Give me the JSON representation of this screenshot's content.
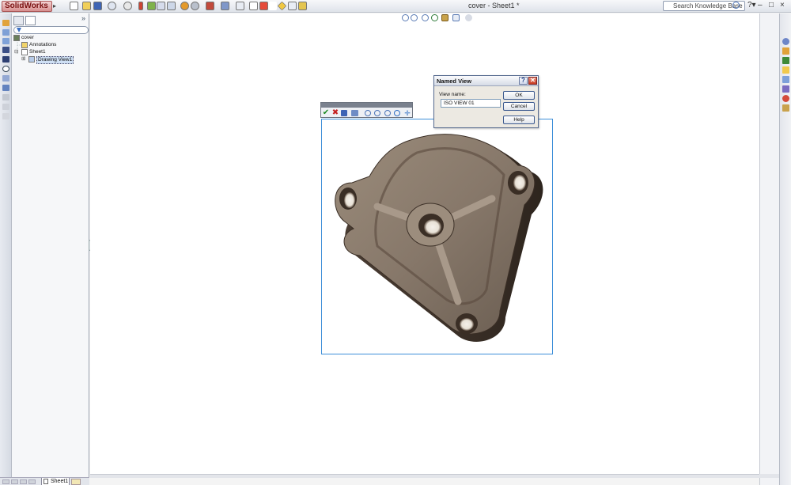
{
  "app": {
    "logo_text": "SolidWorks",
    "document_title": "cover - Sheet1 *",
    "search_placeholder": "Search Knowledge Base"
  },
  "window_controls": {
    "minimize": "–",
    "restore": "□",
    "close": "×"
  },
  "feature_tree": {
    "root": "cover",
    "items": [
      {
        "label": "Annotations",
        "icon": "annotations-icon"
      },
      {
        "label": "Sheet1",
        "icon": "sheet-icon"
      },
      {
        "label": "Drawing View1",
        "icon": "drawing-view-icon"
      }
    ],
    "expand_glyph": "»"
  },
  "sheet_tabs": {
    "active": "Sheet1"
  },
  "view_toolbar": {
    "accept": "✔",
    "cancel": "✖"
  },
  "named_view_dialog": {
    "title": "Named View",
    "help_glyph": "?",
    "close_glyph": "✕",
    "view_name_label": "View name:",
    "view_name_value": "ISO VIEW 01",
    "ok_label": "OK",
    "cancel_label": "Cancel",
    "help_label": "Help"
  },
  "colors": {
    "accent": "#3d8ed8",
    "part_face": "#8a7b6b",
    "part_shadow": "#3d3128"
  }
}
